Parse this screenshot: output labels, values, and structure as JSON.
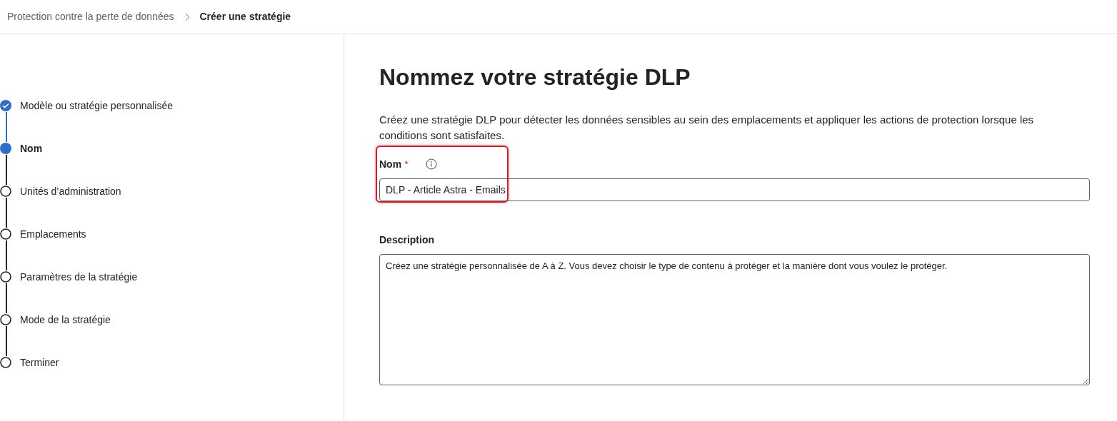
{
  "breadcrumb": [
    {
      "label": "Protection contre la perte de données",
      "current": false
    },
    {
      "label": "Créer une stratégie",
      "current": true
    }
  ],
  "steps": [
    {
      "label": "Modèle ou stratégie personnalisée",
      "completed": true,
      "selected": false
    },
    {
      "label": "Nom",
      "completed": false,
      "selected": true
    },
    {
      "label": "Unités d’administration",
      "completed": false,
      "selected": false
    },
    {
      "label": "Emplacements",
      "completed": false,
      "selected": false
    },
    {
      "label": "Paramètres de la stratégie",
      "completed": false,
      "selected": false
    },
    {
      "label": "Mode de la stratégie",
      "completed": false,
      "selected": false
    },
    {
      "label": "Terminer",
      "completed": false,
      "selected": false
    }
  ],
  "title": "Nommez votre stratégie DLP",
  "intro": "Créez une stratégie DLP pour détecter les données sensibles au sein des emplacements et appliquer les actions de protection lorsque les conditions sont satisfaites.",
  "name_field": {
    "label": "Nom",
    "required_mark": "*",
    "value": "DLP - Article Astra - Emails",
    "highlighted": true
  },
  "description_field": {
    "label": "Description",
    "value": "Créez une stratégie personnalisée de A à Z. Vous devez choisir le type de contenu à protéger et la manière dont vous voulez le protéger."
  }
}
